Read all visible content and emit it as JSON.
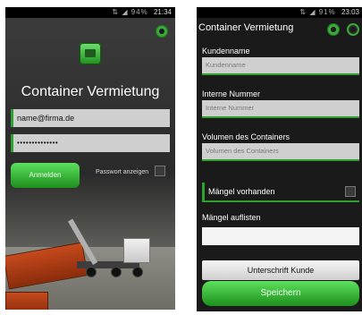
{
  "colors": {
    "accent": "#2ea22e",
    "dark": "#1a1a1a",
    "field": "#cfcfcf"
  },
  "left": {
    "status": {
      "signal": "⇅ ◢ 94%",
      "time": "21:34"
    },
    "title": "Container Vermietung",
    "email_value": "name@firma.de",
    "password_value": "••••••••••••••",
    "login_label": "Anmelden",
    "show_password_label": "Passwort anzeigen",
    "icons": {
      "settings": "gear-icon",
      "app": "app-logo-icon"
    }
  },
  "right": {
    "status": {
      "signal": "⇅ ◢ 91%",
      "time": "23:03"
    },
    "title": "Container Vermietung",
    "kundenname": {
      "label": "Kundenname",
      "placeholder": "Kundenname"
    },
    "interne_nummer": {
      "label": "Interne Nummer",
      "placeholder": "Interne Nummer"
    },
    "volumen": {
      "label": "Volumen des Containers",
      "placeholder": "Volumen des Containers"
    },
    "mangel_vorhanden": "Mängel vorhanden",
    "mangel_auflisten": "Mängel auflisten",
    "signature_label": "Unterschrift Kunde",
    "save_label": "Speichern",
    "icons": {
      "settings": "gear-icon",
      "refresh": "refresh-icon"
    }
  }
}
